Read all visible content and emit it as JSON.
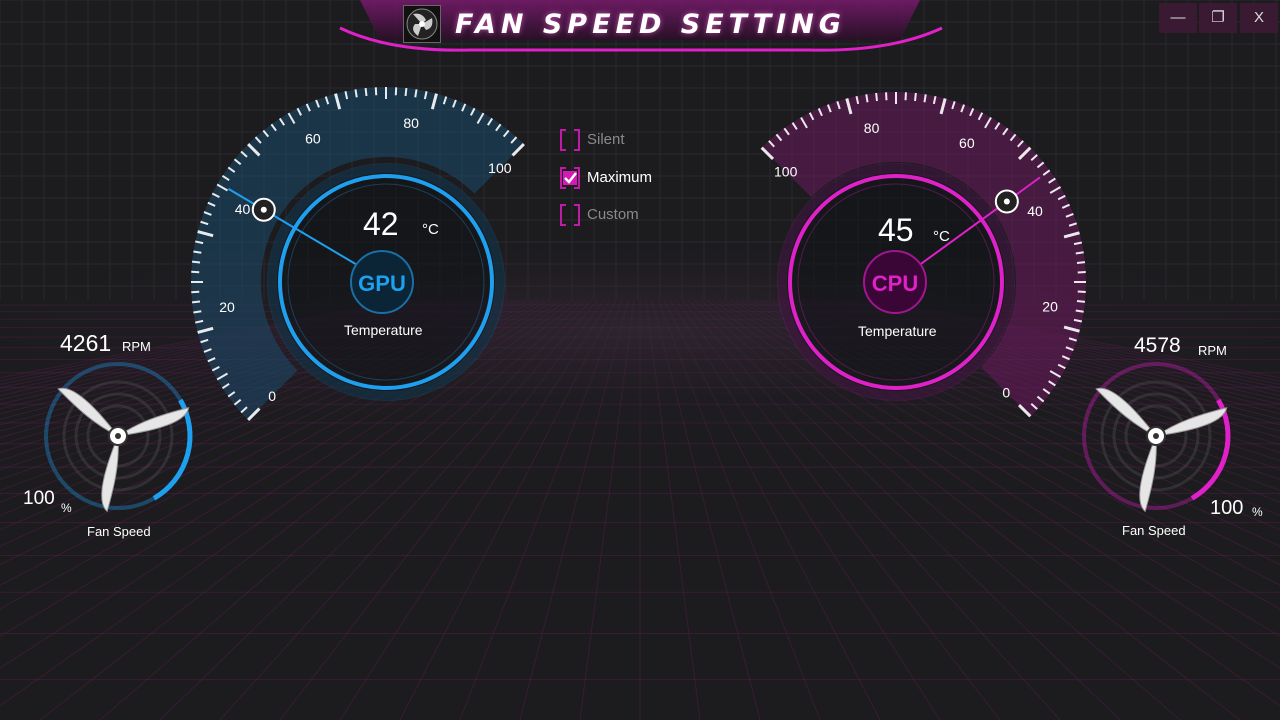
{
  "window": {
    "title": "FAN SPEED SETTING",
    "controls": [
      "—",
      "❐",
      "X"
    ]
  },
  "colors": {
    "gpu_accent": "#1ea0f0",
    "cpu_accent": "#e020c8",
    "background": "#1c1b1e"
  },
  "modes": [
    {
      "label": "Silent",
      "checked": false
    },
    {
      "label": "Maximum",
      "checked": true
    },
    {
      "label": "Custom",
      "checked": false
    }
  ],
  "gpu": {
    "badge": "GPU",
    "temperature": "42",
    "temp_value": 42,
    "unit": "°C",
    "label": "Temperature",
    "scale_ticks": [
      "0",
      "20",
      "40",
      "60",
      "80",
      "100"
    ],
    "fan": {
      "rpm": "4261",
      "rpm_unit": "RPM",
      "percent": "100",
      "percent_unit": "%",
      "label": "Fan Speed"
    }
  },
  "cpu": {
    "badge": "CPU",
    "temperature": "45",
    "temp_value": 45,
    "unit": "°C",
    "label": "Temperature",
    "scale_ticks": [
      "0",
      "20",
      "40",
      "60",
      "80",
      "100"
    ],
    "fan": {
      "rpm": "4578",
      "rpm_unit": "RPM",
      "percent": "100",
      "percent_unit": "%",
      "label": "Fan Speed"
    }
  }
}
